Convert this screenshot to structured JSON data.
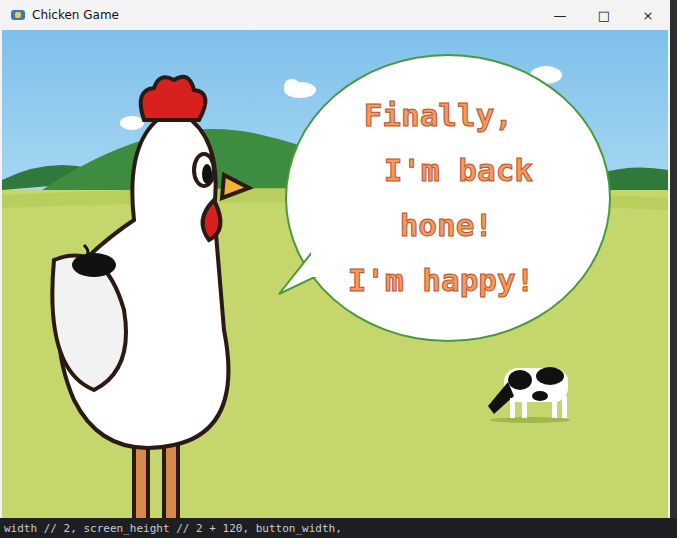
{
  "window": {
    "title": "Chicken Game",
    "controls": [
      "—",
      "□",
      "×"
    ]
  },
  "speech": {
    "lines": [
      "Finally,",
      "I'm back",
      "hone!",
      "I'm happy!"
    ]
  },
  "background_code": {
    "text": "width // 2, screen_height // 2 + 120, button_width,"
  }
}
